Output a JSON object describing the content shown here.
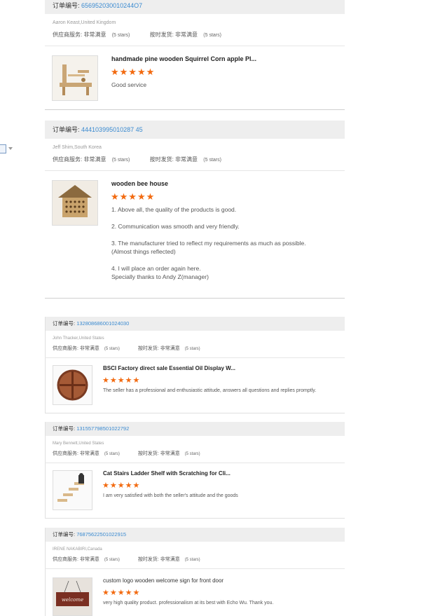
{
  "orders": [
    {
      "order_label": "订单编号:",
      "order_number": "656952030010244O7",
      "buyer": "Aaron Keast,United Kingdom",
      "supplier_label": "供应商服务: 非常满意",
      "supplier_stars": "(5 stars)",
      "shipping_label": "按时发货: 非常满意",
      "shipping_stars": "(5 stars)",
      "product_title": "handmade pine wooden Squirrel Corn apple Pl...",
      "product_image": "squirrel-feeder-image",
      "stars": "★★★★★",
      "review": "Good service"
    },
    {
      "order_label": "订单编号:",
      "order_number": "444103995010287 45",
      "buyer": "Jeff Shim,South Korea",
      "supplier_label": "供应商服务: 非常满意",
      "supplier_stars": "(5 stars)",
      "shipping_label": "按时发货: 非常满意",
      "shipping_stars": "(5 stars)",
      "product_title": "wooden bee house",
      "product_image": "bee-house-image",
      "stars": "★★★★★",
      "review": "1. Above all, the quality of the products is good.\n\n2. Communication was smooth and very friendly.\n\n3. The manufacturer tried to reflect my requirements as much as possible.\n(Almost things reflected)\n\n4. I will place an order again here.\nSpecially thanks to Andy Z(manager)"
    },
    {
      "order_label": "订单编号:",
      "order_number": "132808686001024030",
      "buyer": "John Thacker,United States",
      "supplier_label": "供应商服务: 非常满意",
      "supplier_stars": "(5 stars)",
      "shipping_label": "按时发货: 非常满意",
      "shipping_stars": "(5 stars)",
      "product_title": "BSCI Factory direct sale Essential Oil Display W...",
      "product_image": "essential-oil-shelf-image",
      "stars": "★★★★★",
      "review": "The seller has a professional and enthusiastic attitude, answers all questions and replies promptly."
    },
    {
      "order_label": "订单编号:",
      "order_number": "131557798501022792",
      "buyer": "Mary Bennett,United States",
      "supplier_label": "供应商服务: 非常满意",
      "supplier_stars": "(5 stars)",
      "shipping_label": "按时发货: 非常满意",
      "shipping_stars": "(5 stars)",
      "product_title": "Cat Stairs Ladder Shelf with Scratching for Cli...",
      "product_image": "cat-stairs-image",
      "stars": "★★★★★",
      "review": "I am very satisfied with both the seller's attitude and the goods"
    },
    {
      "order_label": "订单编号:",
      "order_number": "76875622501022915",
      "buyer": "IRENE NAKABIRI,Canada",
      "supplier_label": "供应商服务: 非常满意",
      "supplier_stars": "(5 stars)",
      "shipping_label": "按时发货: 非常满意",
      "shipping_stars": "(5 stars)",
      "product_title": "custom logo wooden welcome sign for front door",
      "product_image": "welcome-sign-image",
      "product_image_text": "welcome",
      "stars": "★★★★★",
      "review": "very high quality product. professionalism at its best with Echo Wu. Thank you."
    }
  ]
}
